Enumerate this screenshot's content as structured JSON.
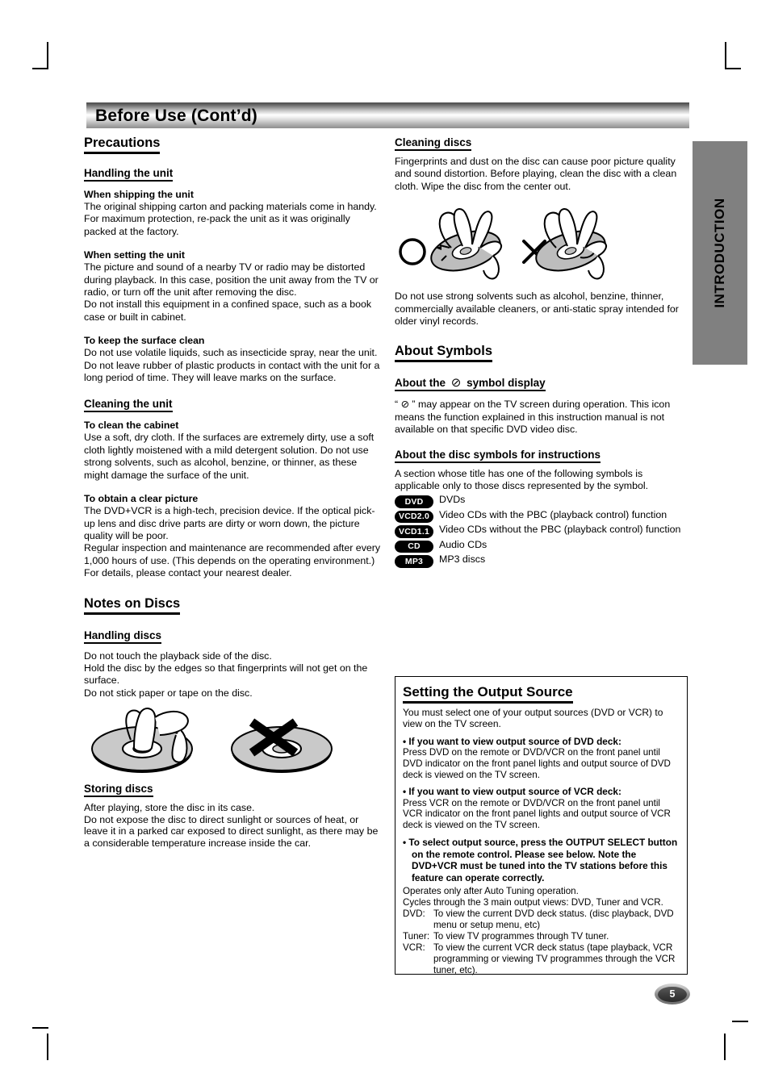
{
  "header": {
    "title": "Before Use (Cont’d)"
  },
  "side_tab": {
    "label": "INTRODUCTION"
  },
  "page_number": "5",
  "left_column": {
    "precautions": {
      "heading": "Precautions",
      "handling_the_unit": {
        "heading": "Handling the unit",
        "blocks": [
          {
            "label": "When shipping the unit",
            "text": "The original shipping carton and packing materials come in handy. For maximum protection, re-pack the unit as it was originally packed at the factory."
          },
          {
            "label": "When setting the unit",
            "text": "The picture and sound of a nearby TV or radio may be distorted during playback. In this case, position the unit away from the TV or radio, or turn off the unit after removing the disc.",
            "text2": "Do not install this equipment in a confined space, such as a book case or built in cabinet."
          },
          {
            "label": "To keep the surface clean",
            "text": "Do not use volatile liquids, such as insecticide spray, near the unit. Do not leave rubber of plastic products in contact with the unit for a long period of time. They will leave marks on the surface."
          }
        ]
      },
      "cleaning_the_unit": {
        "heading": "Cleaning the unit",
        "blocks": [
          {
            "label": "To clean the cabinet",
            "text": "Use a soft, dry cloth. If the surfaces are extremely dirty, use a soft cloth lightly moistened with a mild detergent solution. Do not use strong solvents, such as alcohol, benzine, or thinner, as these might damage the surface of the unit."
          },
          {
            "label": "To obtain a clear picture",
            "text": "The DVD+VCR is a high-tech, precision device. If the optical pick-up lens and disc drive parts are dirty or worn down, the picture quality will be poor.",
            "text2": "Regular inspection and maintenance are recommended after every 1,000 hours of use. (This depends on the operating environment.)",
            "text3": "For details, please contact your nearest dealer."
          }
        ]
      }
    },
    "notes_on_discs": {
      "heading": "Notes on Discs",
      "handling_discs": {
        "heading": "Handling discs",
        "text": "Do not touch the playback side of the disc.\nHold the disc by the edges so that fingerprints will not get on the surface.\nDo not stick paper or tape on the disc."
      },
      "storing_discs": {
        "heading": "Storing discs",
        "text": "After playing, store the disc in its case.\nDo not expose the disc to direct sunlight or sources of heat, or leave it in a parked car exposed to direct sunlight, as there may be a considerable temperature increase inside the car."
      }
    }
  },
  "right_column": {
    "cleaning_discs": {
      "heading": "Cleaning discs",
      "text": "Fingerprints and dust on the disc can cause poor picture quality and sound distortion. Before playing, clean the disc with a clean cloth. Wipe the disc from the center out.",
      "text2": "Do not use strong solvents such as alcohol, benzine, thinner, commercially available cleaners, or anti-static spray intended for older vinyl records."
    },
    "about_symbols": {
      "heading": "About Symbols",
      "symbol_display": {
        "heading_before": "About the",
        "heading_symbol": "⊘",
        "heading_after": "symbol display",
        "text": "“ ⊘ ” may appear on the TV screen during operation. This icon means the function explained in this instruction manual is not available on that specific DVD video disc."
      },
      "disc_symbols": {
        "heading": "About the disc symbols for instructions",
        "intro": "A section whose title has one of the following symbols is applicable only to those discs represented by the symbol.",
        "items": [
          {
            "badge": "DVD",
            "text": "DVDs"
          },
          {
            "badge": "VCD2.0",
            "text": "Video CDs with the PBC (playback control) function"
          },
          {
            "badge": "VCD1.1",
            "text": "Video CDs without the PBC (playback control) function"
          },
          {
            "badge": "CD",
            "text": "Audio CDs"
          },
          {
            "badge": "MP3",
            "text": "MP3 discs"
          }
        ]
      }
    },
    "output_source": {
      "heading": "Setting the Output Source",
      "intro": "You must select one of your output sources (DVD or VCR) to view on the TV screen.",
      "bullet1_title": "•  If you want to view output source of DVD deck:",
      "bullet1_text": "Press DVD on the remote or DVD/VCR on the front panel until DVD indicator on the front panel lights and output source of DVD deck is viewed on the TV screen.",
      "bullet2_title": "•  If you want to view output source of VCR deck:",
      "bullet2_text": "Press VCR on the remote or DVD/VCR on the front panel until VCR indicator on the front panel lights and output source of VCR deck is viewed on the TV screen.",
      "bullet3_title": "•  To select output source, press the OUTPUT SELECT button on the remote control. Please see below. Note the DVD+VCR must be tuned into the TV stations before this feature can operate correctly.",
      "note1": "Operates only after Auto Tuning operation.",
      "note2": "Cycles through the 3 main output views: DVD, Tuner and VCR.",
      "definitions": [
        {
          "key": "DVD:",
          "value": "To view the current DVD deck status. (disc playback, DVD menu or setup menu, etc)"
        },
        {
          "key": "Tuner:",
          "value": "To view TV programmes through TV tuner."
        },
        {
          "key": "VCR:",
          "value": "To view the current VCR deck status (tape playback, VCR programming or viewing TV programmes through the VCR tuner, etc)."
        }
      ]
    }
  }
}
